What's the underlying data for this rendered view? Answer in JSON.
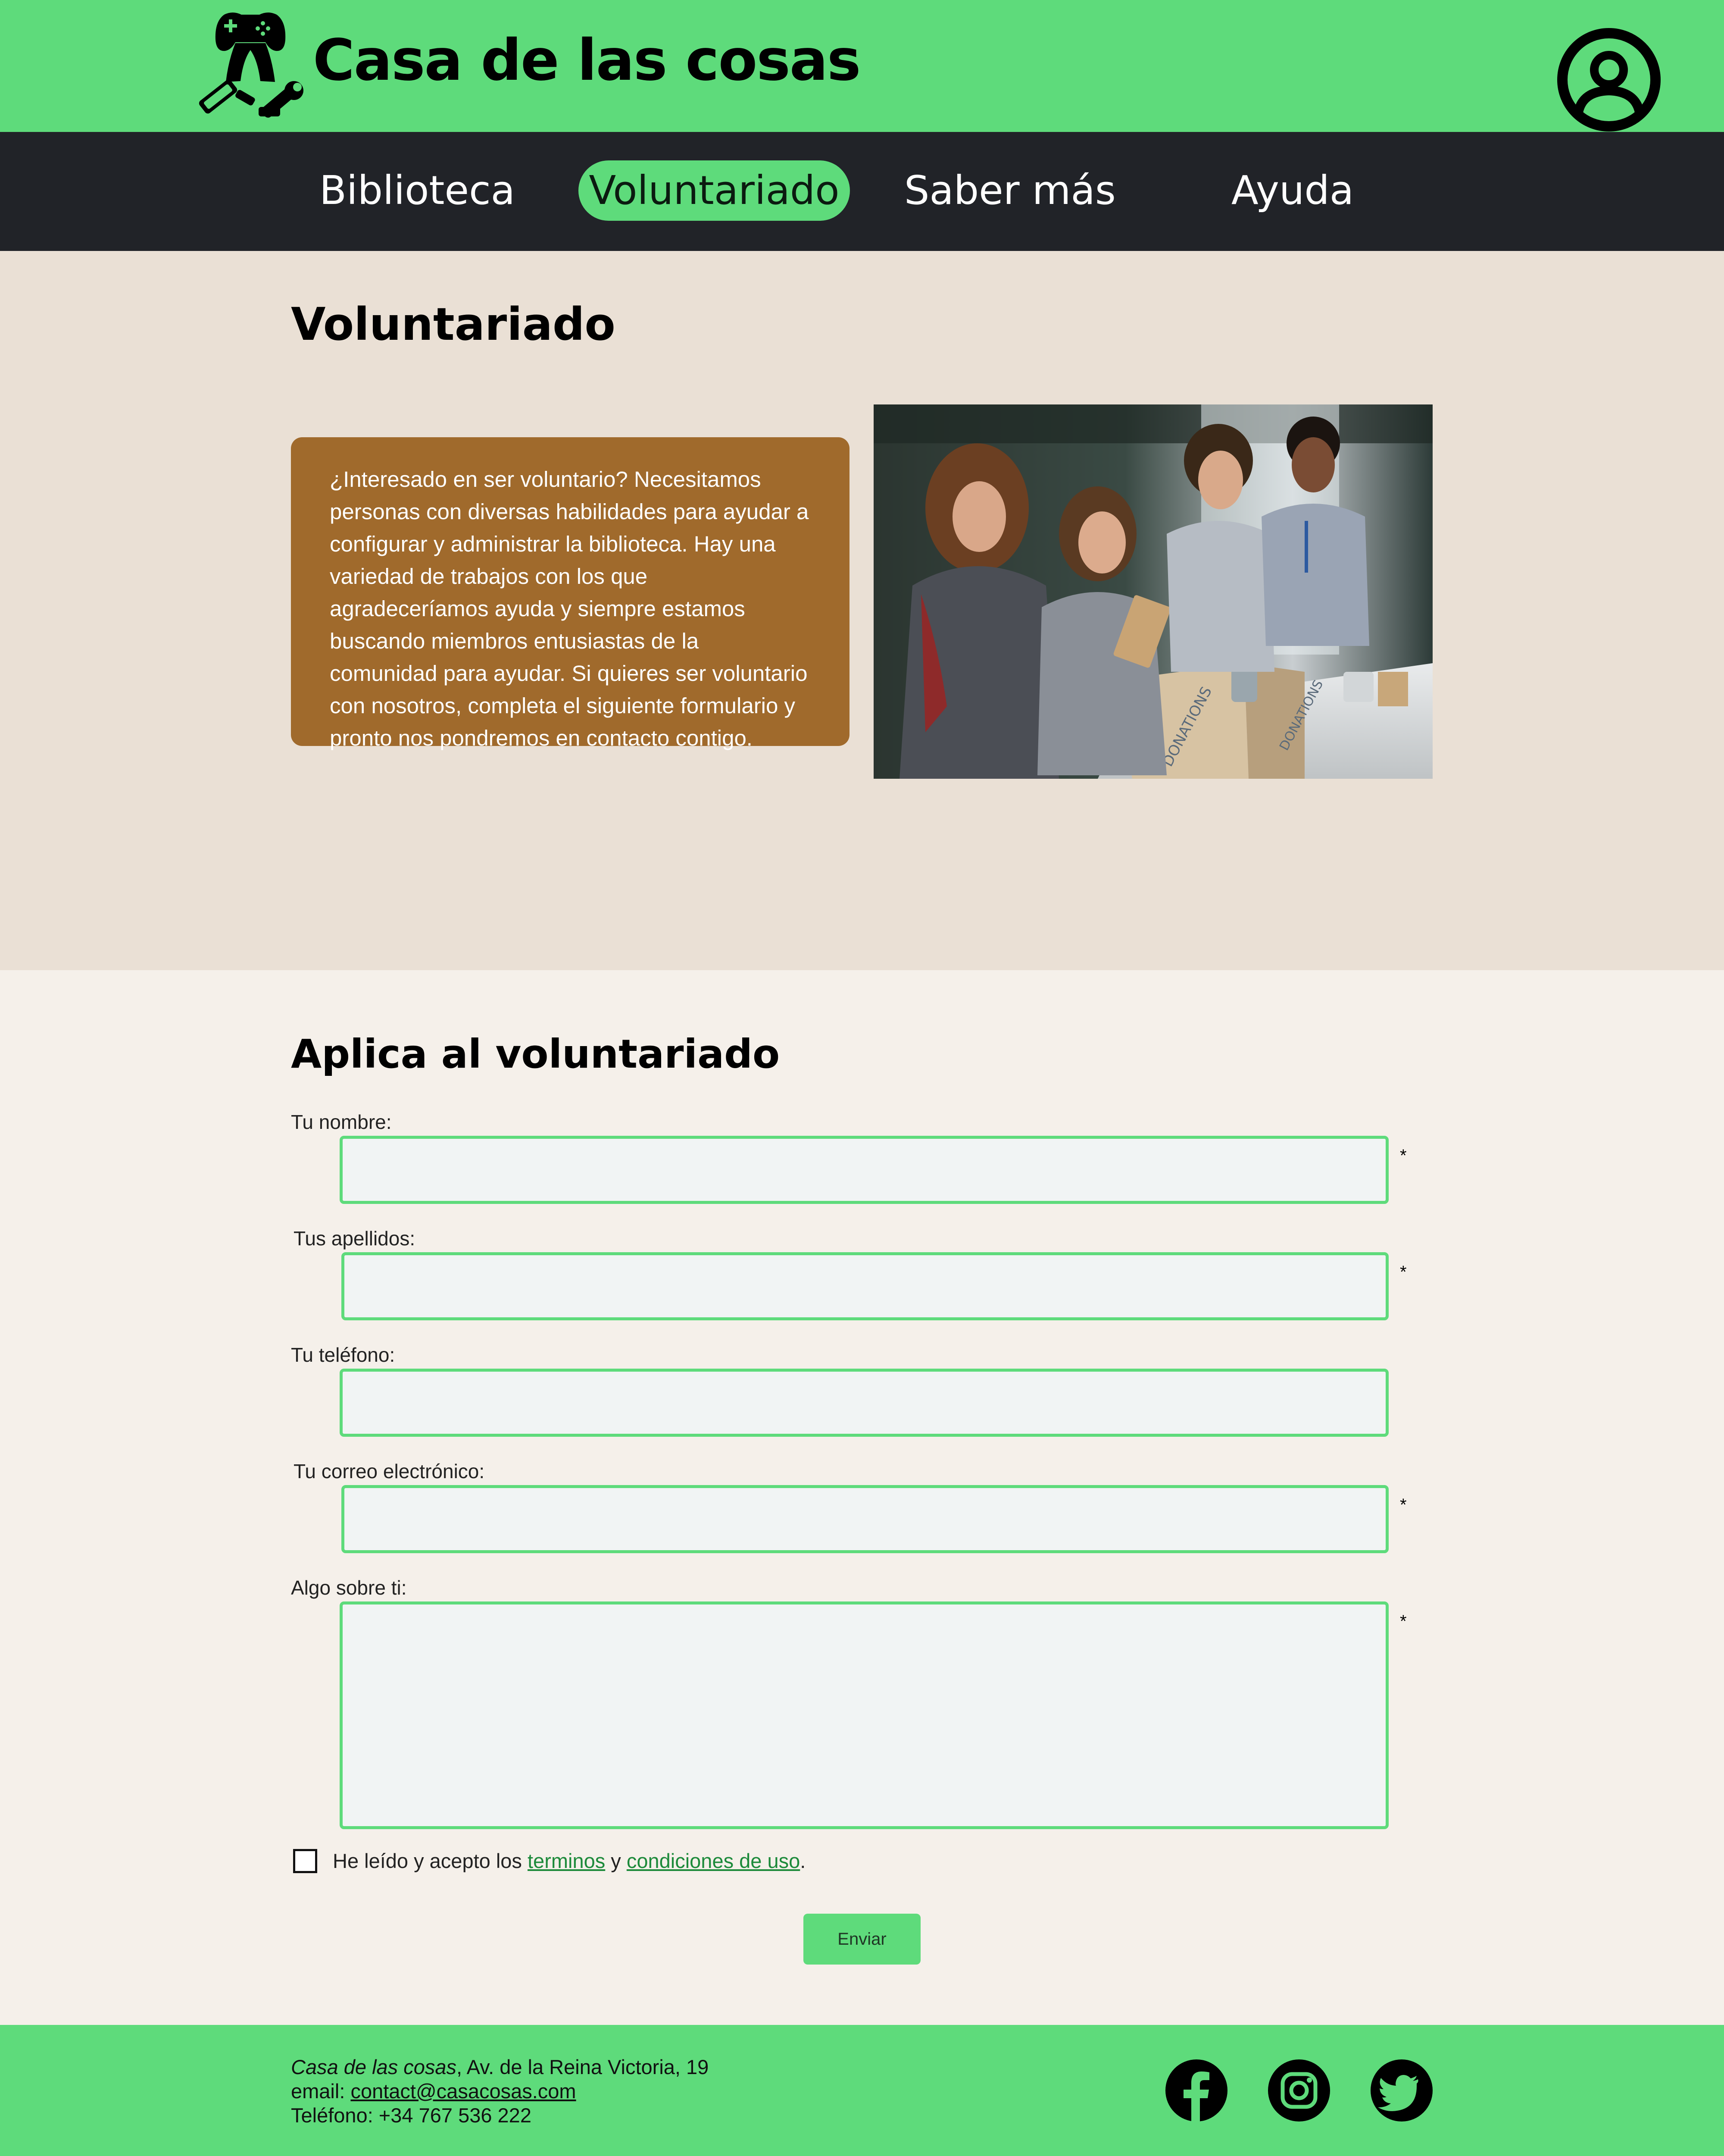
{
  "header": {
    "site_title": "Casa de las cosas",
    "logo_icon": "gamepad-tools-logo-icon",
    "user_icon": "user-account-icon",
    "background_color": "#5edb7b"
  },
  "nav": {
    "background_color": "#212328",
    "active_color": "#5edb7b",
    "items": [
      {
        "label": "Biblioteca",
        "active": false
      },
      {
        "label": "Voluntariado",
        "active": true
      },
      {
        "label": "Saber más",
        "active": false
      },
      {
        "label": "Ayuda",
        "active": false
      }
    ]
  },
  "hero": {
    "title": "Voluntariado",
    "card_color": "#a06a2c",
    "text": "¿Interesado en ser voluntario? Necesitamos personas con diversas habilidades para ayudar a configurar y administrar la biblioteca. Hay una variedad de trabajos con los que agradeceríamos ayuda y siempre estamos buscando miembros entusiastas de la comunidad para ayudar. Si quieres ser voluntario con nosotros, completa el siguiente formulario y pronto nos pondremos en contacto contigo.",
    "photo_box_text_1": "DONATIONS",
    "photo_box_text_2": "DONATIONS"
  },
  "form": {
    "title": "Aplica al voluntariado",
    "required_mark": "*",
    "fields": {
      "name": {
        "label": "Tu nombre:",
        "value": "",
        "required": true
      },
      "surname": {
        "label": "Tus apellidos:",
        "value": "",
        "required": true
      },
      "phone": {
        "label": "Tu teléfono:",
        "value": "",
        "required": false
      },
      "email": {
        "label": "Tu correo electrónico:",
        "value": "",
        "required": true
      },
      "about": {
        "label": "Algo sobre ti:",
        "value": "",
        "required": true
      }
    },
    "terms": {
      "prefix": "He leído y acepto los ",
      "link1": "terminos",
      "middle": " y ",
      "link2": "condiciones de uso",
      "suffix": ".",
      "checked": false
    },
    "submit_label": "Enviar"
  },
  "footer": {
    "org_name": "Casa de las cosas",
    "address": ", Av. de la Reina Victoria, 19",
    "email_prefix": "email: ",
    "email": "contact@casacosas.com",
    "phone_text": "Teléfono: +34 767 536 222",
    "social_icons": [
      "facebook-icon",
      "instagram-icon",
      "twitter-icon"
    ]
  }
}
